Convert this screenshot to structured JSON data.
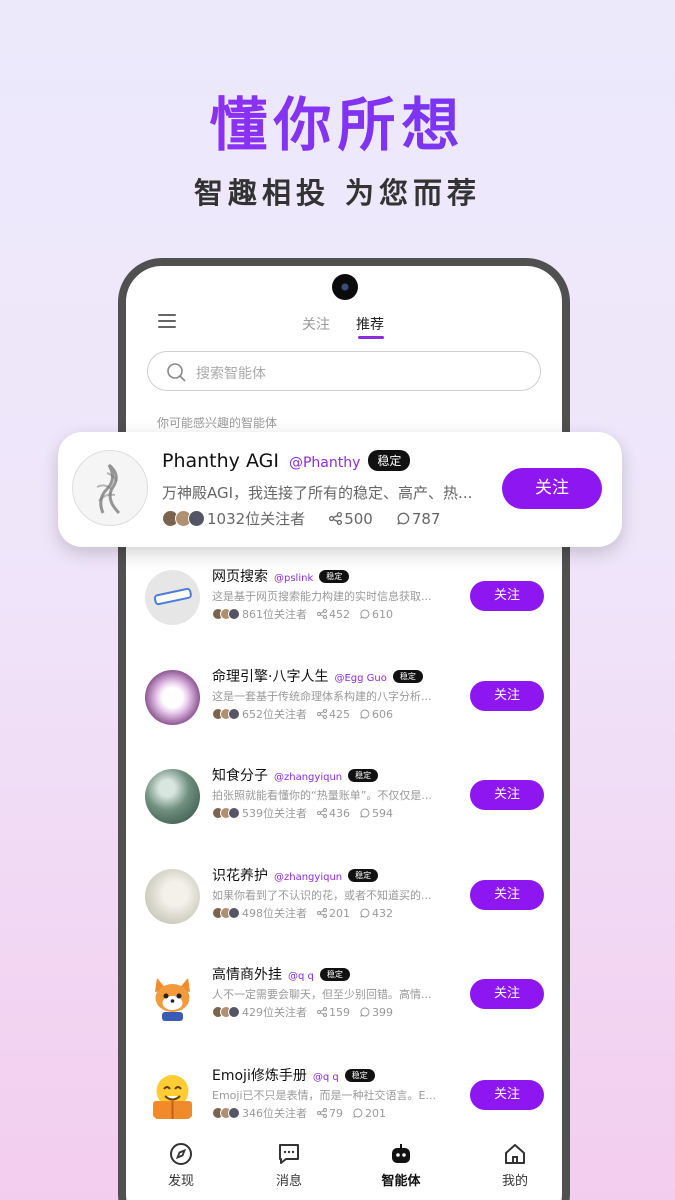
{
  "headline": "懂你所想",
  "subline": "智趣相投   为您而荐",
  "tabs": {
    "following": "关注",
    "recommend": "推荐"
  },
  "search": {
    "placeholder": "搜索智能体"
  },
  "section_label": "你可能感兴趣的智能体",
  "featured": {
    "name": "Phanthy AGI",
    "handle": "@Phanthy",
    "badge": "稳定",
    "desc": "万神殿AGI，我连接了所有的稳定、高产、热...",
    "followers": "1032位关注者",
    "shares": "500",
    "comments": "787",
    "follow_label": "关注"
  },
  "agents": [
    {
      "name": "网页搜索",
      "handle": "@pslink",
      "badge": "稳定",
      "desc": "这是基于网页搜索能力构建的实时信息获取...",
      "followers": "861位关注者",
      "shares": "452",
      "comments": "610",
      "follow_label": "关注",
      "avatar_icon": "search-bar-icon"
    },
    {
      "name": "命理引擎·八字人生",
      "handle": "@Egg Guo",
      "badge": "稳定",
      "desc": "这是一套基于传统命理体系构建的八字分析...",
      "followers": "652位关注者",
      "shares": "425",
      "comments": "606",
      "follow_label": "关注",
      "avatar_icon": "glow-chat-icon"
    },
    {
      "name": "知食分子",
      "handle": "@zhangyiqun",
      "badge": "稳定",
      "desc": "拍张照就能看懂你的“热量账单”。不仅仅是...",
      "followers": "539位关注者",
      "shares": "436",
      "comments": "594",
      "follow_label": "关注",
      "avatar_icon": "forest-icon"
    },
    {
      "name": "识花养护",
      "handle": "@zhangyiqun",
      "badge": "稳定",
      "desc": "如果你看到了不认识的花，或者不知道买的...",
      "followers": "498位关注者",
      "shares": "201",
      "comments": "432",
      "follow_label": "关注",
      "avatar_icon": "flower-icon"
    },
    {
      "name": "高情商外挂",
      "handle": "@q q",
      "badge": "稳定",
      "desc": "人不一定需要会聊天，但至少别回错。高情...",
      "followers": "429位关注者",
      "shares": "159",
      "comments": "399",
      "follow_label": "关注",
      "avatar_icon": "fox-icon"
    },
    {
      "name": "Emoji修炼手册",
      "handle": "@q q",
      "badge": "稳定",
      "desc": "Emoji已不只是表情，而是一种社交语言。E...",
      "followers": "346位关注者",
      "shares": "79",
      "comments": "201",
      "follow_label": "关注",
      "avatar_icon": "emoji-book-icon"
    }
  ],
  "nav": [
    {
      "label": "发现",
      "icon": "compass-icon"
    },
    {
      "label": "消息",
      "icon": "message-icon"
    },
    {
      "label": "智能体",
      "icon": "robot-icon",
      "active": true
    },
    {
      "label": "我的",
      "icon": "home-icon"
    }
  ],
  "colors": {
    "accent": "#8e16f0",
    "handle": "#8a2be2"
  }
}
